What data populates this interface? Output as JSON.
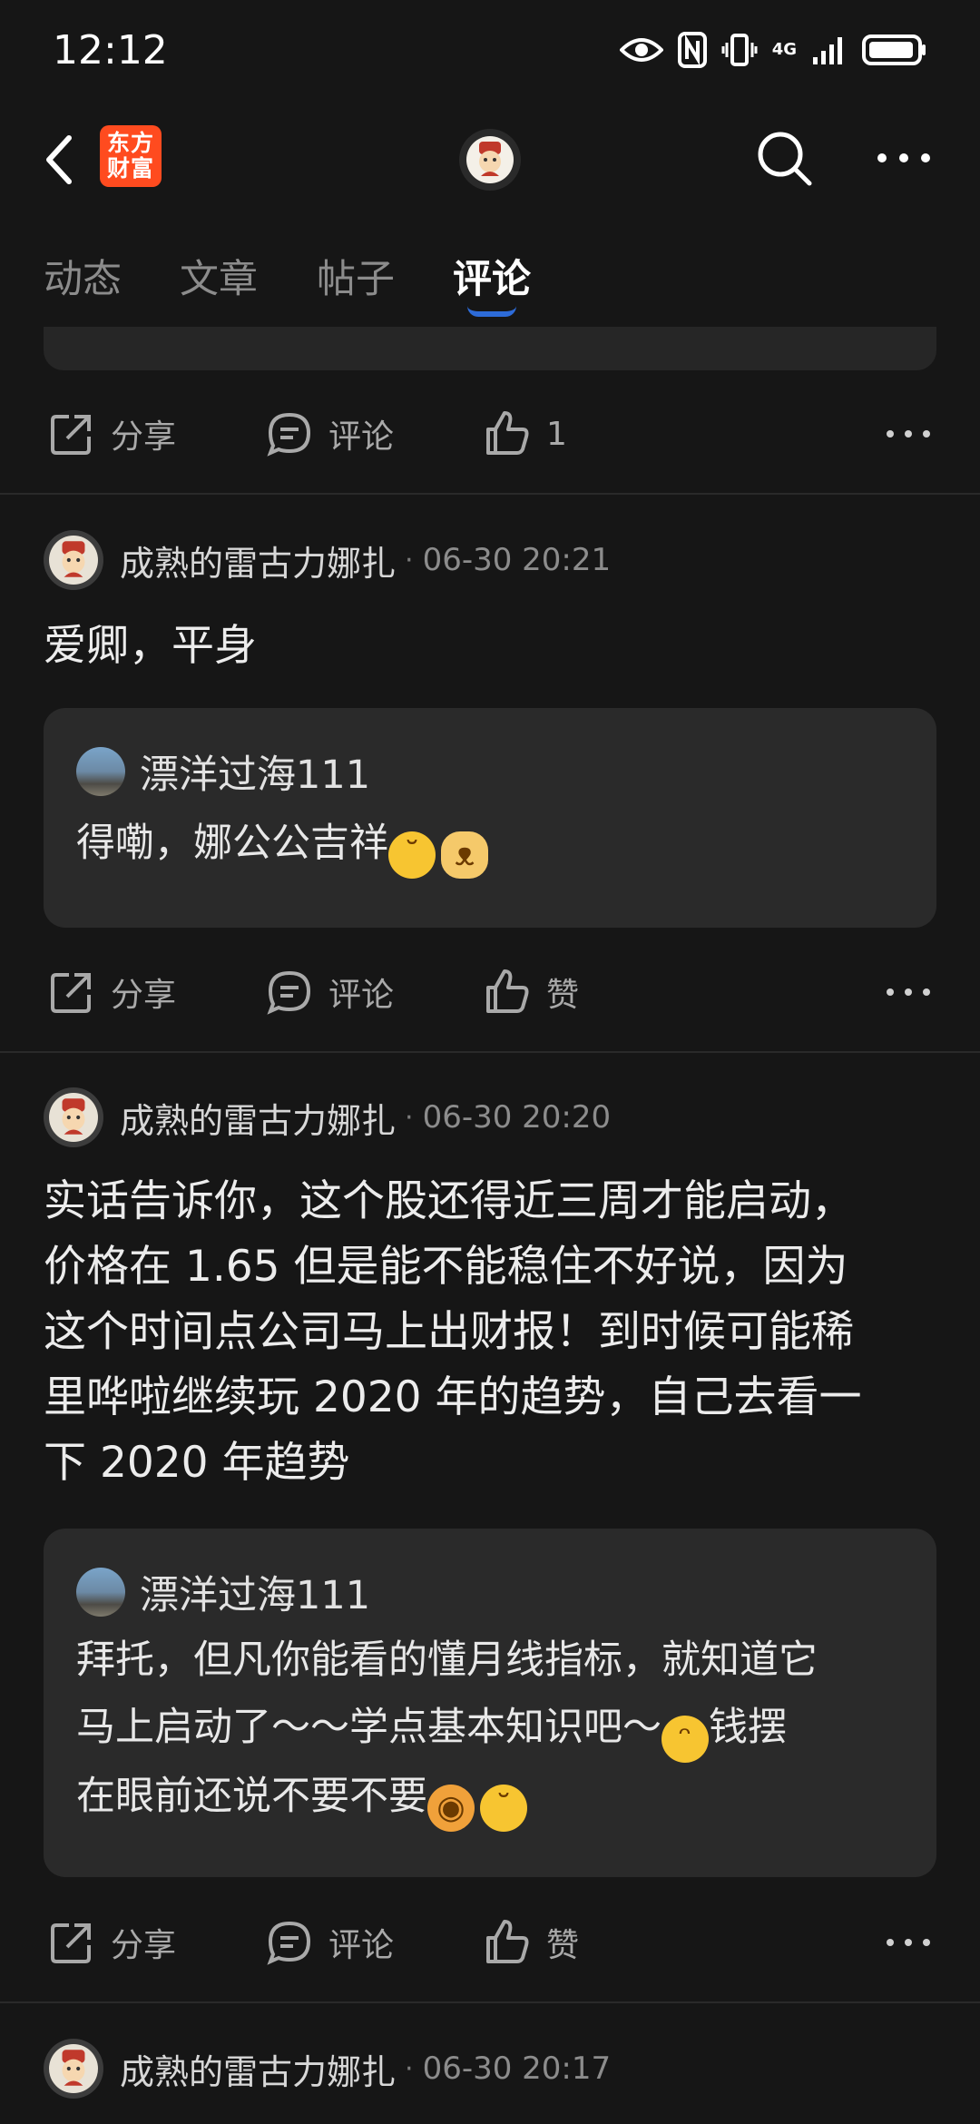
{
  "status_bar": {
    "time": "12:12",
    "network": "4G"
  },
  "nav": {
    "brand_line1": "东方",
    "brand_line2": "财富"
  },
  "tabs": [
    "动态",
    "文章",
    "帖子",
    "评论"
  ],
  "active_tab": 3,
  "actions": {
    "share": "分享",
    "comment": "评论",
    "like": "赞"
  },
  "first_actions": {
    "like_count": "1"
  },
  "comments": [
    {
      "author": "成熟的雷古力娜扎",
      "time": "06-30 20:21",
      "body": "爱卿，平身",
      "reply": {
        "author": "漂洋过海111",
        "text_parts": [
          "得嘞，娜公公吉祥"
        ]
      }
    },
    {
      "author": "成熟的雷古力娜扎",
      "time": "06-30 20:20",
      "body_lines": [
        "实话告诉你，这个股还得近三周才能启动，",
        "价格在 1.65 但是能不能稳住不好说，因为",
        "这个时间点公司马上出财报！到时候可能稀",
        "里哗啦继续玩 2020 年的趋势，自己去看一",
        "下 2020 年趋势"
      ],
      "reply": {
        "author": "漂洋过海111",
        "lines": [
          "拜托，但凡你能看的懂月线指标，就知道它",
          "马上启动了～～学点基本知识吧～",
          "钱摆",
          "在眼前还说不要不要"
        ]
      }
    },
    {
      "author": "成熟的雷古力娜扎",
      "time": "06-30 20:17"
    }
  ]
}
